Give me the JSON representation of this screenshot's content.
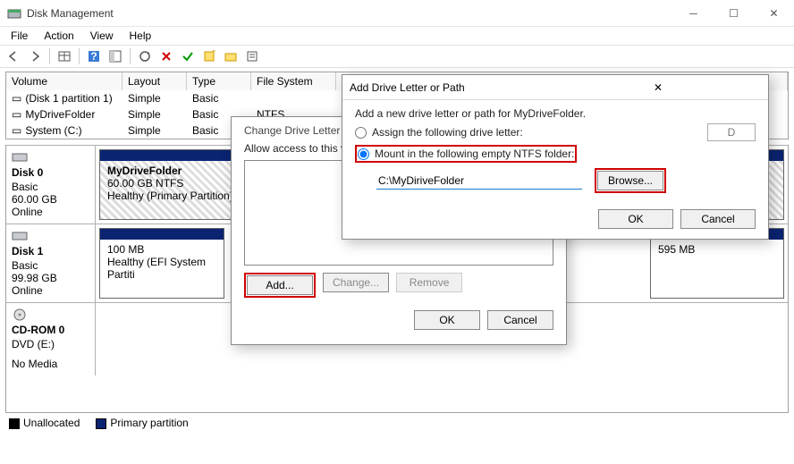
{
  "window": {
    "title": "Disk Management"
  },
  "menu": {
    "file": "File",
    "action": "Action",
    "view": "View",
    "help": "Help"
  },
  "columns": {
    "volume": "Volume",
    "layout": "Layout",
    "type": "Type",
    "fs": "File System",
    "status": "S"
  },
  "volumes": [
    {
      "name": "(Disk 1 partition 1)",
      "layout": "Simple",
      "type": "Basic",
      "fs": "",
      "status": "H"
    },
    {
      "name": "MyDriveFolder",
      "layout": "Simple",
      "type": "Basic",
      "fs": "NTFS",
      "status": "H"
    },
    {
      "name": "System (C:)",
      "layout": "Simple",
      "type": "Basic",
      "fs": "",
      "status": ""
    }
  ],
  "disks": {
    "d0": {
      "title": "Disk 0",
      "type": "Basic",
      "size": "60.00 GB",
      "status": "Online",
      "p0": {
        "name": "MyDriveFolder",
        "size": "60.00 GB NTFS",
        "health": "Healthy (Primary Partition)"
      }
    },
    "d1": {
      "title": "Disk 1",
      "type": "Basic",
      "size": "99.98 GB",
      "status": "Online",
      "p0": {
        "size": "100 MB",
        "health": "Healthy (EFI System Partiti"
      },
      "p1": {
        "size": "595 MB"
      }
    },
    "cd": {
      "title": "CD-ROM 0",
      "type": "DVD (E:)",
      "status": "No Media"
    }
  },
  "legend": {
    "unalloc": "Unallocated",
    "primary": "Primary partition"
  },
  "dlg1": {
    "title": "Change Drive Letter a",
    "msg": "Allow access to this volu",
    "add": "Add...",
    "change": "Change...",
    "remove": "Remove",
    "ok": "OK",
    "cancel": "Cancel"
  },
  "dlg2": {
    "title": "Add Drive Letter or Path",
    "msg": "Add a new drive letter or path for MyDriveFolder.",
    "opt1": "Assign the following drive letter:",
    "opt2": "Mount in the following empty NTFS folder:",
    "letter": "D",
    "path": "C:\\MyDiriveFolder",
    "browse": "Browse...",
    "ok": "OK",
    "cancel": "Cancel"
  }
}
